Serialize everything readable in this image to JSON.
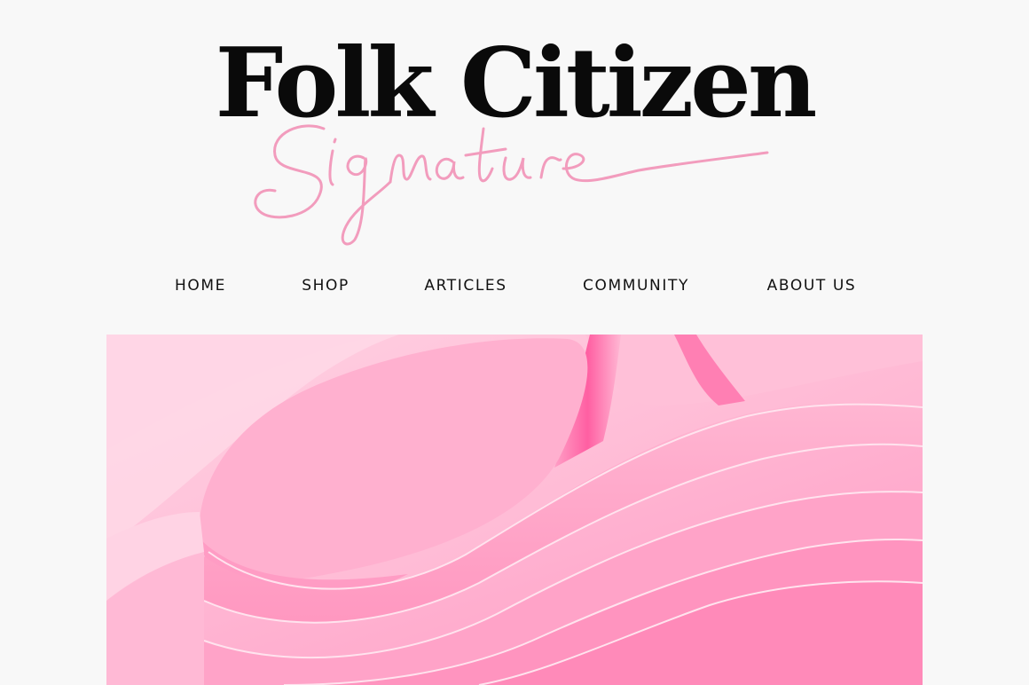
{
  "brand": {
    "title": "Folk Citizen",
    "script": "Signature",
    "script_color": "#f29cbd"
  },
  "nav": {
    "items": [
      {
        "label": "HOME"
      },
      {
        "label": "SHOP"
      },
      {
        "label": "ARTICLES"
      },
      {
        "label": "COMMUNITY"
      },
      {
        "label": "ABOUT US"
      }
    ]
  },
  "hero": {
    "image": "pink-abstract-wavy-ribbons",
    "colors": [
      "#ffb3d0",
      "#ff8fbb",
      "#ff5fa2",
      "#ffd2e3"
    ]
  },
  "colors": {
    "background": "#f8f8f8",
    "text": "#0a0a0a",
    "accent": "#f29cbd"
  }
}
